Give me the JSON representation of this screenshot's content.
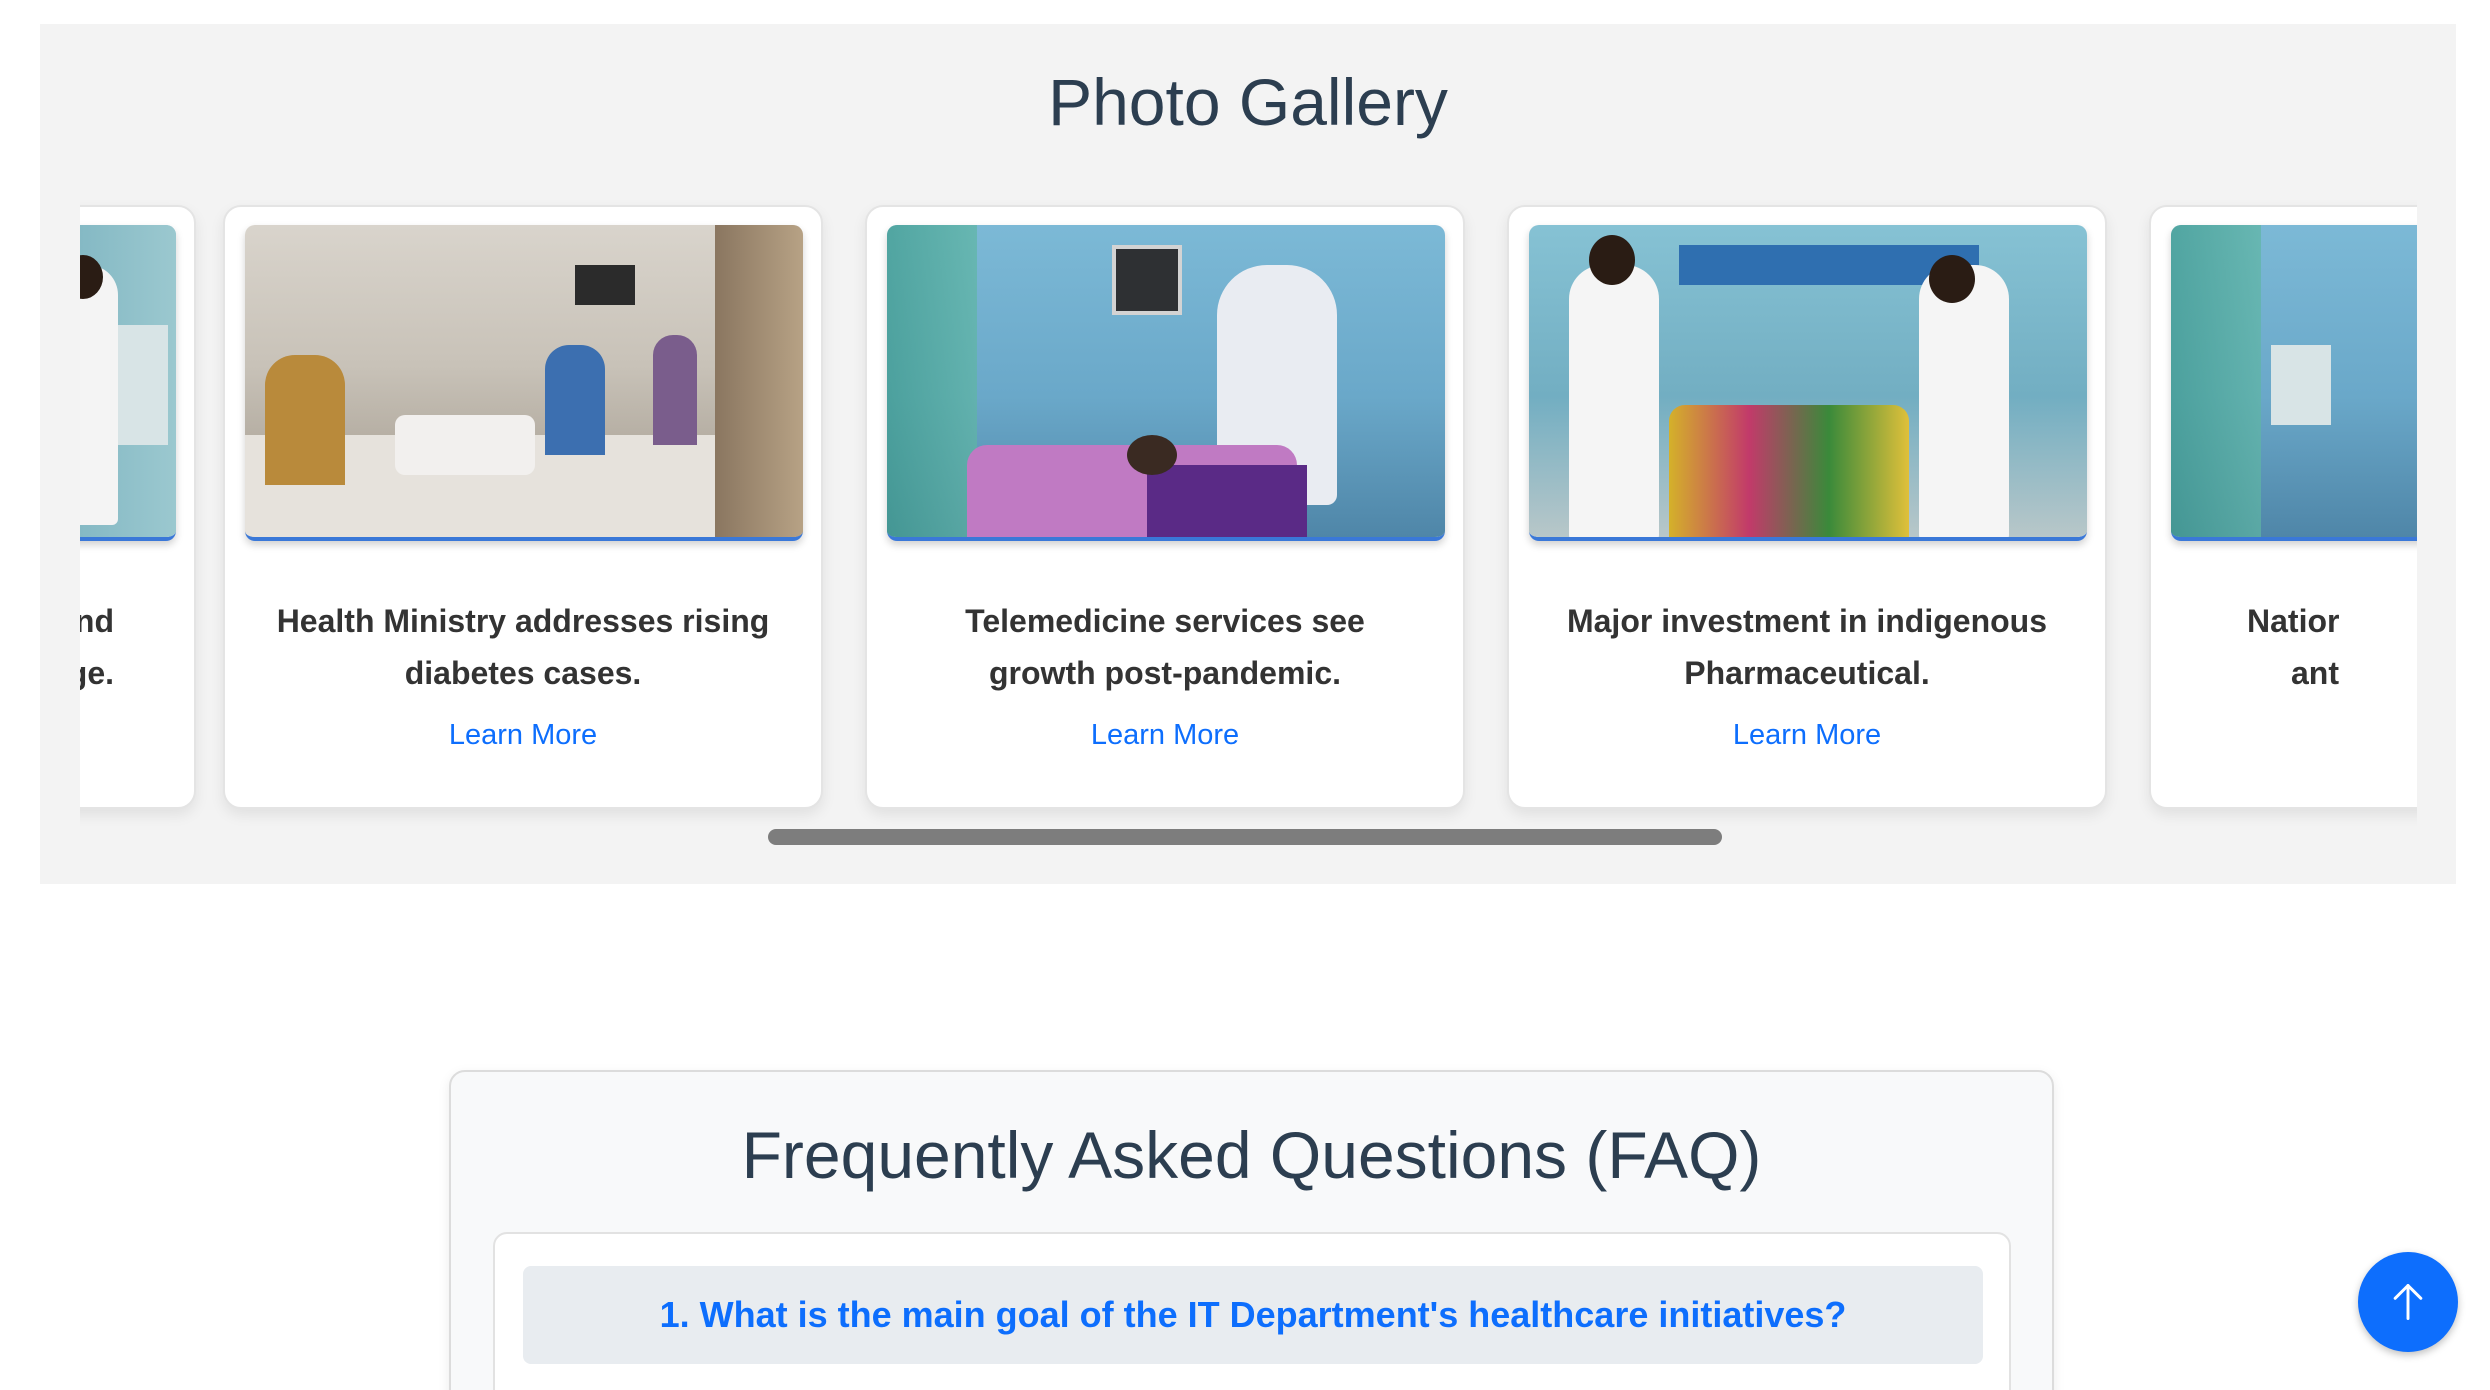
{
  "gallery": {
    "title": "Photo Gallery",
    "cards": [
      {
        "caption_lines": [
          "expand",
          "verage."
        ],
        "link": ""
      },
      {
        "caption_lines": [
          "Health Ministry addresses rising",
          "diabetes cases."
        ],
        "link": "Learn More"
      },
      {
        "caption_lines": [
          "Telemedicine services see",
          "growth post-pandemic."
        ],
        "link": "Learn More"
      },
      {
        "caption_lines": [
          "Major investment in indigenous",
          "Pharmaceutical."
        ],
        "link": "Learn More"
      },
      {
        "caption_lines": [
          "Natior",
          "ant"
        ],
        "link": ""
      }
    ]
  },
  "faq": {
    "title": "Frequently Asked Questions (FAQ)",
    "items": [
      {
        "question": "1. What is the main goal of the IT Department's healthcare initiatives?"
      }
    ]
  },
  "back_to_top": {
    "icon": "arrow-up-icon",
    "color": "#0d6efd"
  },
  "colors": {
    "accent": "#0d6efd",
    "heading": "#2c3e50",
    "section_bg": "#f3f3f3"
  }
}
